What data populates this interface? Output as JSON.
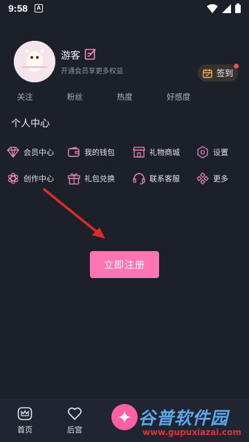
{
  "status_bar": {
    "time": "9:58",
    "notification_glyph": "A",
    "icons": [
      "wifi-icon",
      "signal-icon",
      "battery-icon"
    ]
  },
  "profile": {
    "username": "游客",
    "vip_tip": "开通会员享更多权益",
    "checkin_label": "签到",
    "stats": [
      "关注",
      "粉丝",
      "热度",
      "好感度"
    ]
  },
  "personal_center": {
    "title": "个人中心",
    "items": [
      {
        "label": "会员中心",
        "icon": "diamond-icon"
      },
      {
        "label": "我的钱包",
        "icon": "wallet-icon"
      },
      {
        "label": "礼物商城",
        "icon": "store-icon"
      },
      {
        "label": "设置",
        "icon": "gear-icon"
      },
      {
        "label": "创作中心",
        "icon": "flower-icon"
      },
      {
        "label": "礼包兑换",
        "icon": "gift-icon"
      },
      {
        "label": "联系客服",
        "icon": "headset-icon"
      },
      {
        "label": "更多",
        "icon": "more-icon"
      }
    ]
  },
  "register_button": "立即注册",
  "bottom_nav": [
    {
      "label": "首页",
      "icon": "crown-icon"
    },
    {
      "label": "后宫",
      "icon": "heart-icon"
    }
  ],
  "watermark": {
    "title": "谷普软件园",
    "url": "www.gupuxiazai.com"
  },
  "colors": {
    "background": "#1b2029",
    "accent_pink": "#ff75b4",
    "icon_pink": "#f08cc0",
    "checkin_bg": "#383330",
    "arrow_red": "#e02b2b"
  }
}
